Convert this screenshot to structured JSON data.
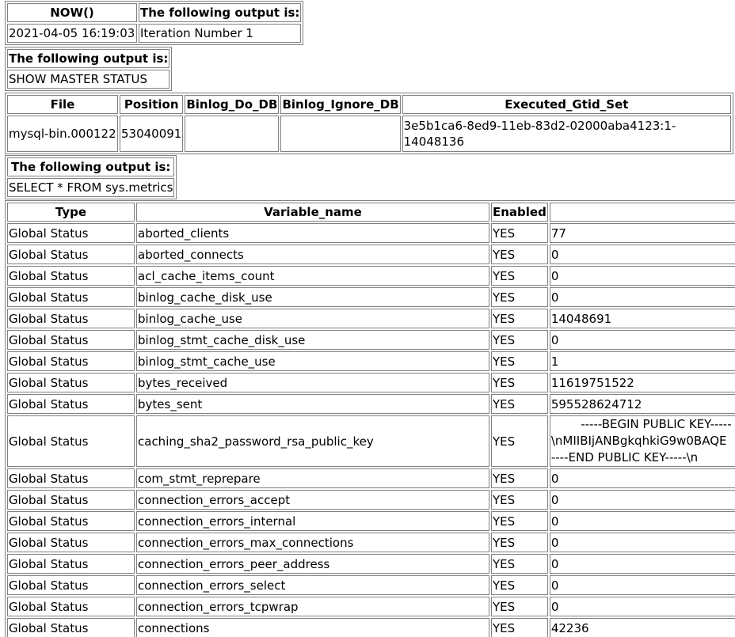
{
  "now_table": {
    "headers": [
      "NOW()",
      "The following output is:"
    ],
    "row": [
      "2021-04-05 16:19:03",
      "Iteration Number 1"
    ]
  },
  "master_label": {
    "header": "The following output is:",
    "value": "SHOW MASTER STATUS"
  },
  "master_status": {
    "headers": [
      "File",
      "Position",
      "Binlog_Do_DB",
      "Binlog_Ignore_DB",
      "Executed_Gtid_Set"
    ],
    "row": [
      "mysql-bin.000122",
      "53040091",
      "",
      "",
      "3e5b1ca6-8ed9-11eb-83d2-02000aba4123:1-14048136"
    ]
  },
  "metrics_label": {
    "header": "The following output is:",
    "value": "SELECT * FROM sys.metrics"
  },
  "metrics": {
    "headers": [
      "Type",
      "Variable_name",
      "Enabled",
      ""
    ],
    "rows": [
      [
        "Global Status",
        "aborted_clients",
        "YES",
        "77"
      ],
      [
        "Global Status",
        "aborted_connects",
        "YES",
        "0"
      ],
      [
        "Global Status",
        "acl_cache_items_count",
        "YES",
        "0"
      ],
      [
        "Global Status",
        "binlog_cache_disk_use",
        "YES",
        "0"
      ],
      [
        "Global Status",
        "binlog_cache_use",
        "YES",
        "14048691"
      ],
      [
        "Global Status",
        "binlog_stmt_cache_disk_use",
        "YES",
        "0"
      ],
      [
        "Global Status",
        "binlog_stmt_cache_use",
        "YES",
        "1"
      ],
      [
        "Global Status",
        "bytes_received",
        "YES",
        "11619751522"
      ],
      [
        "Global Status",
        "bytes_sent",
        "YES",
        "595528624712"
      ],
      [
        "Global Status",
        "caching_sha2_password_rsa_public_key",
        "YES",
        "-----BEGIN PUBLIC KEY-----\\nMIIBIjANBgkqhkiG9w0BAQE----END PUBLIC KEY-----\\n"
      ],
      [
        "Global Status",
        "com_stmt_reprepare",
        "YES",
        "0"
      ],
      [
        "Global Status",
        "connection_errors_accept",
        "YES",
        "0"
      ],
      [
        "Global Status",
        "connection_errors_internal",
        "YES",
        "0"
      ],
      [
        "Global Status",
        "connection_errors_max_connections",
        "YES",
        "0"
      ],
      [
        "Global Status",
        "connection_errors_peer_address",
        "YES",
        "0"
      ],
      [
        "Global Status",
        "connection_errors_select",
        "YES",
        "0"
      ],
      [
        "Global Status",
        "connection_errors_tcpwrap",
        "YES",
        "0"
      ],
      [
        "Global Status",
        "connections",
        "YES",
        "42236"
      ]
    ],
    "key_value_lines": [
      "-----BEGIN PUBLIC KEY-----",
      "\\nMIIBIjANBgkqhkiG9w0BAQE",
      "----END PUBLIC KEY-----\\n"
    ]
  }
}
